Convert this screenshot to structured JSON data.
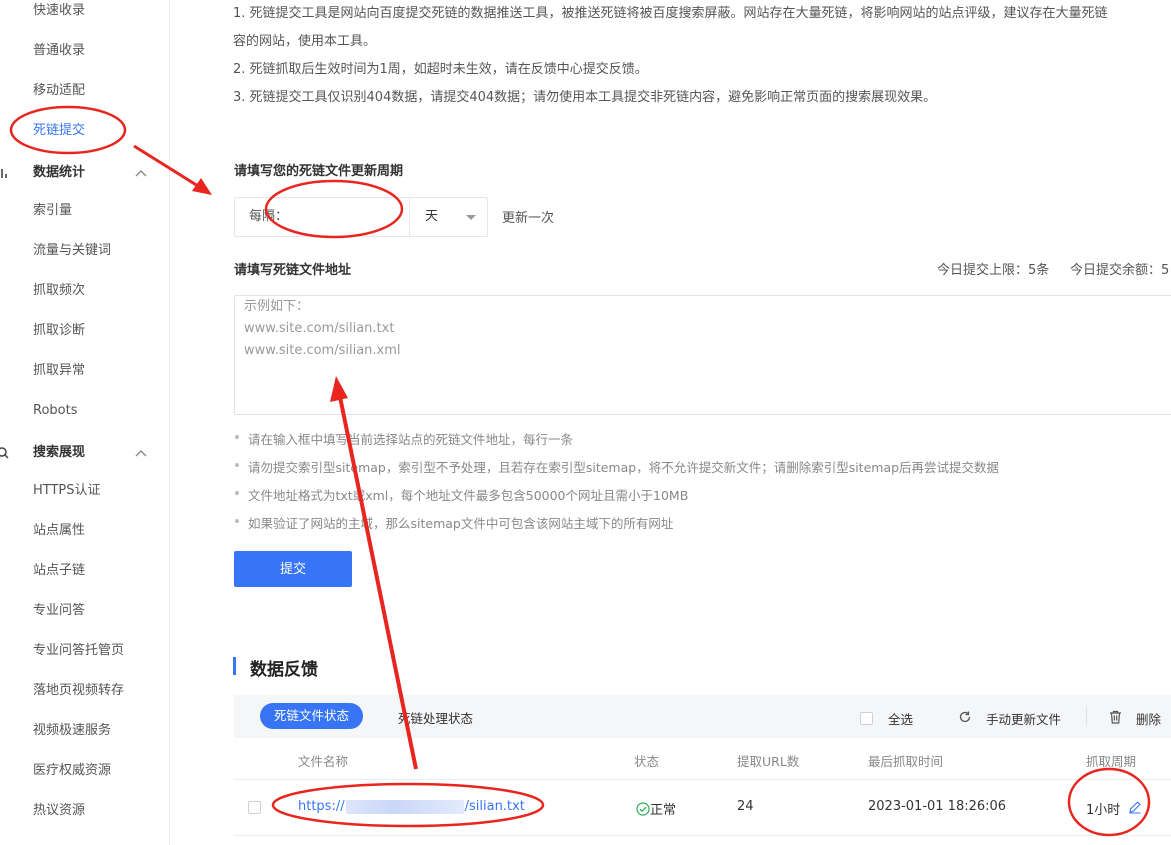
{
  "sidebar": {
    "items_top": [
      "快速收录",
      "普通收录",
      "移动适配",
      "死链提交"
    ],
    "active_index": 3,
    "group_stats": {
      "label": "数据统计",
      "items": [
        "索引量",
        "流量与关键词",
        "抓取频次",
        "抓取诊断",
        "抓取异常",
        "Robots"
      ]
    },
    "group_search": {
      "label": "搜索展现",
      "items": [
        "HTTPS认证",
        "站点属性",
        "站点子链",
        "专业问答",
        "专业问答托管页",
        "落地页视频转存",
        "视频极速服务",
        "医疗权威资源",
        "热议资源"
      ]
    }
  },
  "notice": {
    "line1": "1. 死链提交工具是网站向百度提交死链的数据推送工具，被推送死链将被百度搜索屏蔽。网站存在大量死链，将影响网站的站点评级，建议存在大量死链",
    "line1b": "容的网站，使用本工具。",
    "line2": "2. 死链抓取后生效时间为1周，如超时未生效，请在反馈中心提交反馈。",
    "line3": "3. 死链提交工具仅识别404数据，请提交404数据；请勿使用本工具提交非死链内容，避免影响正常页面的搜索展现效果。"
  },
  "frequency": {
    "label": "请填写您的死链文件更新周期",
    "prefix": "每隔：",
    "unit": "天",
    "suffix": "更新一次"
  },
  "address": {
    "label": "请填写死链文件地址",
    "quota_limit": "今日提交上限：5条",
    "quota_left": "今日提交余额：5",
    "placeholder_lines": [
      "示例如下：",
      "www.site.com/silian.txt",
      "www.site.com/silian.xml"
    ]
  },
  "tips": [
    "请在输入框中填写当前选择站点的死链文件地址，每行一条",
    "请勿提交索引型sitemap，索引型不予处理，且若存在索引型sitemap，将不允许提交新文件；请删除索引型sitemap后再尝试提交数据",
    "文件地址格式为txt或xml，每个地址文件最多包含50000个网址且需小于10MB",
    "如果验证了网站的主域，那么sitemap文件中可包含该网站主域下的所有网址"
  ],
  "submit_label": "提交",
  "feedback": {
    "title": "数据反馈",
    "tab_active": "死链文件状态",
    "tab_inactive": "死链处理状态",
    "select_all": "全选",
    "manual_update": "手动更新文件",
    "delete": "删除",
    "columns": [
      "文件名称",
      "状态",
      "提取URL数",
      "最后抓取时间",
      "抓取周期"
    ],
    "rows": [
      {
        "file_prefix": "https://",
        "file_suffix": "/silian.txt",
        "status": "正常",
        "url_count": "24",
        "last_crawl": "2023-01-01 18:26:06",
        "period": "1小时"
      }
    ]
  },
  "colors": {
    "accent": "#3875f6",
    "annotation": "#e8261f"
  }
}
